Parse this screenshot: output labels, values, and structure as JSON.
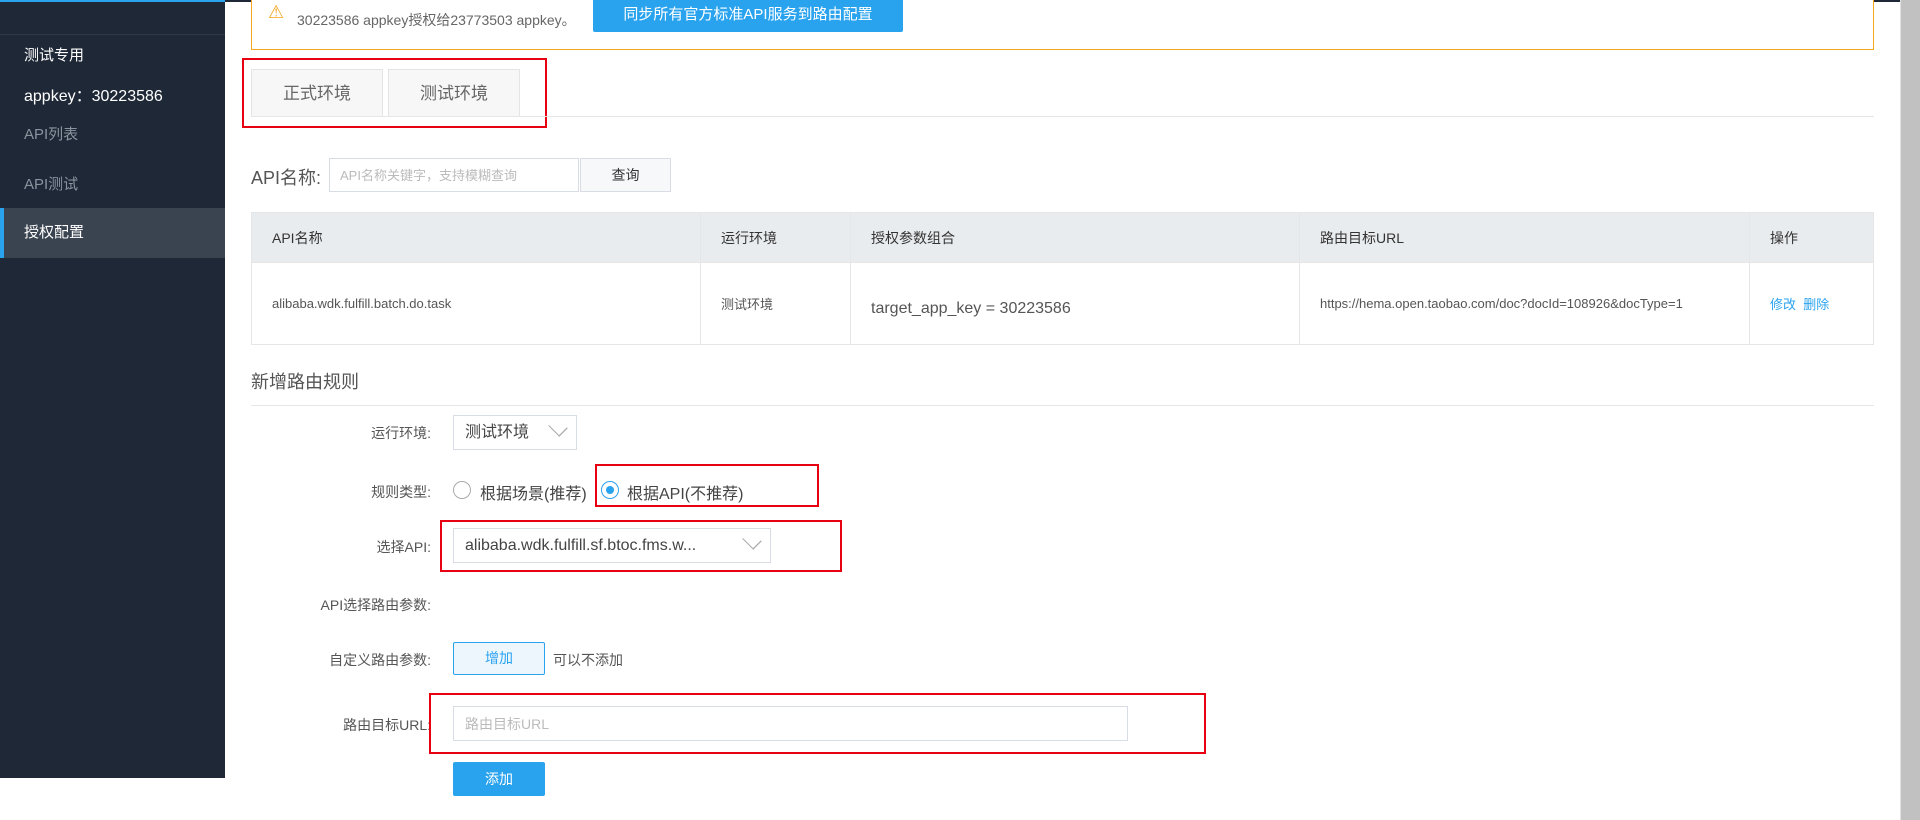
{
  "sidebar": {
    "section_title": "测试专用",
    "appkey_label": "appkey：30223586",
    "items": [
      {
        "label": "API列表",
        "active": false
      },
      {
        "label": "API测试",
        "active": false
      },
      {
        "label": "授权配置",
        "active": true
      }
    ]
  },
  "alert": {
    "icon": "warning-icon",
    "text": "30223586 appkey授权给23773503 appkey。",
    "sync_button": "同步所有官方标准API服务到路由配置"
  },
  "tabs": [
    {
      "label": "正式环境"
    },
    {
      "label": "测试环境"
    }
  ],
  "search": {
    "label": "API名称:",
    "placeholder": "API名称关键字，支持模糊查询",
    "button": "查询"
  },
  "table": {
    "headers": [
      "API名称",
      "运行环境",
      "授权参数组合",
      "路由目标URL",
      "操作"
    ],
    "rows": [
      {
        "api": "alibaba.wdk.fulfill.batch.do.task",
        "env": "测试环境",
        "params": "target_app_key = 30223586",
        "url": "https://hema.open.taobao.com/doc?docId=108926&docType=1",
        "edit": "修改",
        "delete": "删除"
      }
    ]
  },
  "form": {
    "title": "新增路由规则",
    "env_label": "运行环境:",
    "env_value": "测试环境",
    "rule_type_label": "规则类型:",
    "rule_options": [
      "根据场景(推荐)",
      "根据API(不推荐)"
    ],
    "rule_selected": "根据API(不推荐)",
    "api_label": "选择API:",
    "api_value": "alibaba.wdk.fulfill.sf.btoc.fms.w...",
    "api_params_label": "API选择路由参数:",
    "custom_params_label": "自定义路由参数:",
    "add_param_button": "增加",
    "add_param_hint": "可以不添加",
    "url_label": "路由目标URL:",
    "url_placeholder": "路由目标URL",
    "submit_button": "添加"
  },
  "colors": {
    "accent": "#2aa3ef",
    "sidebar": "#1e2836",
    "alert_border": "#f5a623",
    "highlight": "#e60012"
  }
}
